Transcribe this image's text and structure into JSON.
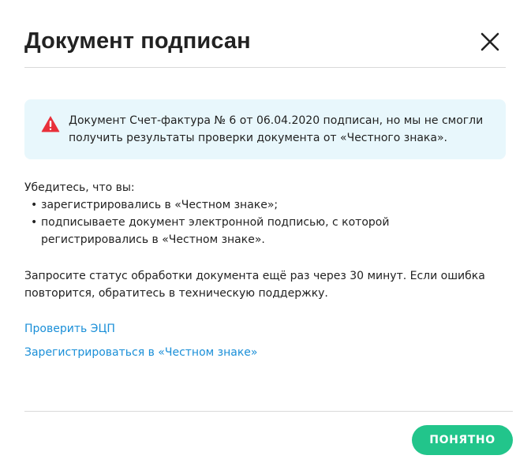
{
  "dialog": {
    "title": "Документ подписан",
    "close_icon": "close-icon"
  },
  "alert": {
    "icon": "warning-triangle-icon",
    "color": "#e8303a",
    "background": "#e8f7fc",
    "text": "Документ Счет-фактура № 6 от 06.04.2020 подписан, но мы не смогли получить результаты проверки документа от «Честного знака»."
  },
  "checklist": {
    "intro": "Убедитесь, что вы:",
    "items": [
      {
        "bullet": "•",
        "text": "зарегистрировались в «Честном знаке»;"
      },
      {
        "bullet": "•",
        "text": "подписываете документ электронной подписью, с которой регистрировались в «Честном знаке»."
      }
    ]
  },
  "notice": "Запросите статус обработки документа ещё раз через 30 минут. Если ошибка повторится, обратитесь в техническую поддержку.",
  "links": {
    "check_signature": "Проверить ЭЦП",
    "register": "Зарегистрироваться в «Честном знаке»",
    "color": "#1a8fd8"
  },
  "footer": {
    "ok_label": "ПОНЯТНО",
    "ok_color": "#22c58b"
  }
}
